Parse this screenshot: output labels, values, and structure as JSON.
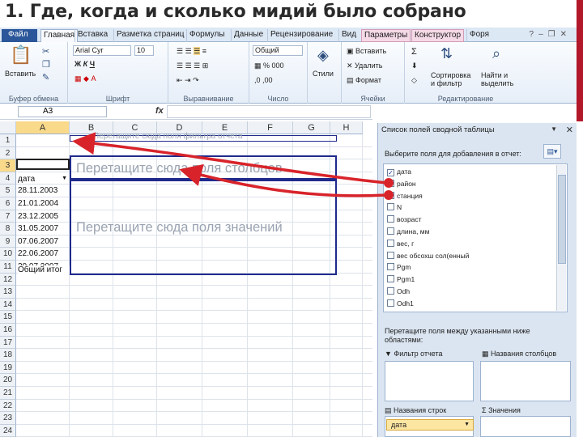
{
  "title": "1. Где, когда и сколько мидий было собрано",
  "tabs": [
    {
      "label": "Файл"
    },
    {
      "label": "Главная"
    },
    {
      "label": "Вставка"
    },
    {
      "label": "Разметка страниц"
    },
    {
      "label": "Формулы"
    },
    {
      "label": "Данные"
    },
    {
      "label": "Рецензирование"
    },
    {
      "label": "Вид"
    },
    {
      "label": "Параметры"
    },
    {
      "label": "Конструктор"
    },
    {
      "label": "Форя"
    }
  ],
  "ribbon": {
    "paste_label": "Вставить",
    "clipboard": "Буфер обмена",
    "font_name": "Arial Cyr",
    "font_size": "10",
    "font_group": "Шрифт",
    "number_format": "Общий",
    "number_group": "Число",
    "alignment_group": "Выравнивание",
    "styles_label": "Стили",
    "insert_label": "Вставить",
    "delete_label": "Удалить",
    "format_label": "Формат",
    "cells_group": "Ячейки",
    "sort_label": "Сортировка и фильтр",
    "find_label": "Найти и выделить",
    "editing_group": "Редактирование"
  },
  "namebox": "A3",
  "fx": "fx",
  "columns": [
    "A",
    "B",
    "C",
    "D",
    "E",
    "F",
    "G",
    "H"
  ],
  "rows": [
    "1",
    "2",
    "3",
    "4",
    "5",
    "6",
    "7",
    "8",
    "9",
    "10",
    "11",
    "12",
    "13",
    "14",
    "15",
    "16",
    "17",
    "18",
    "19",
    "20",
    "21",
    "22",
    "23",
    "24",
    "25"
  ],
  "cells": {
    "a4": "дата",
    "dates": [
      "28.11.2003",
      "21.01.2004",
      "23.12.2005",
      "31.05.2007",
      "07.06.2007",
      "22.06.2007",
      "30.07.2007"
    ],
    "total": "Общий итог"
  },
  "drop_zones": {
    "filter": "Перетащите сюда поля фильтра отчета",
    "columns": "Перетащите сюда поля столбцов",
    "values": "Перетащите сюда поля значений"
  },
  "panel": {
    "title": "Список полей сводной таблицы",
    "choose": "Выберите поля для добавления в отчет:",
    "fields": [
      {
        "label": "дата",
        "checked": true
      },
      {
        "label": "район",
        "checked": false
      },
      {
        "label": "станция",
        "checked": false
      },
      {
        "label": "N",
        "checked": false
      },
      {
        "label": "возраст",
        "checked": false
      },
      {
        "label": "длина, мм",
        "checked": false
      },
      {
        "label": "вес, г",
        "checked": false
      },
      {
        "label": "вес обсохш сол(енный",
        "checked": false
      },
      {
        "label": "Pgm",
        "checked": false
      },
      {
        "label": "Pgm1",
        "checked": false
      },
      {
        "label": "Odh",
        "checked": false
      },
      {
        "label": "Odh1",
        "checked": false
      }
    ],
    "drag_label": "Перетащите поля между указанными ниже областями:",
    "report_filter": "Фильтр отчета",
    "column_labels": "Названия столбцов",
    "row_labels": "Названия строк",
    "values": "Значения",
    "row_item": "дата"
  }
}
